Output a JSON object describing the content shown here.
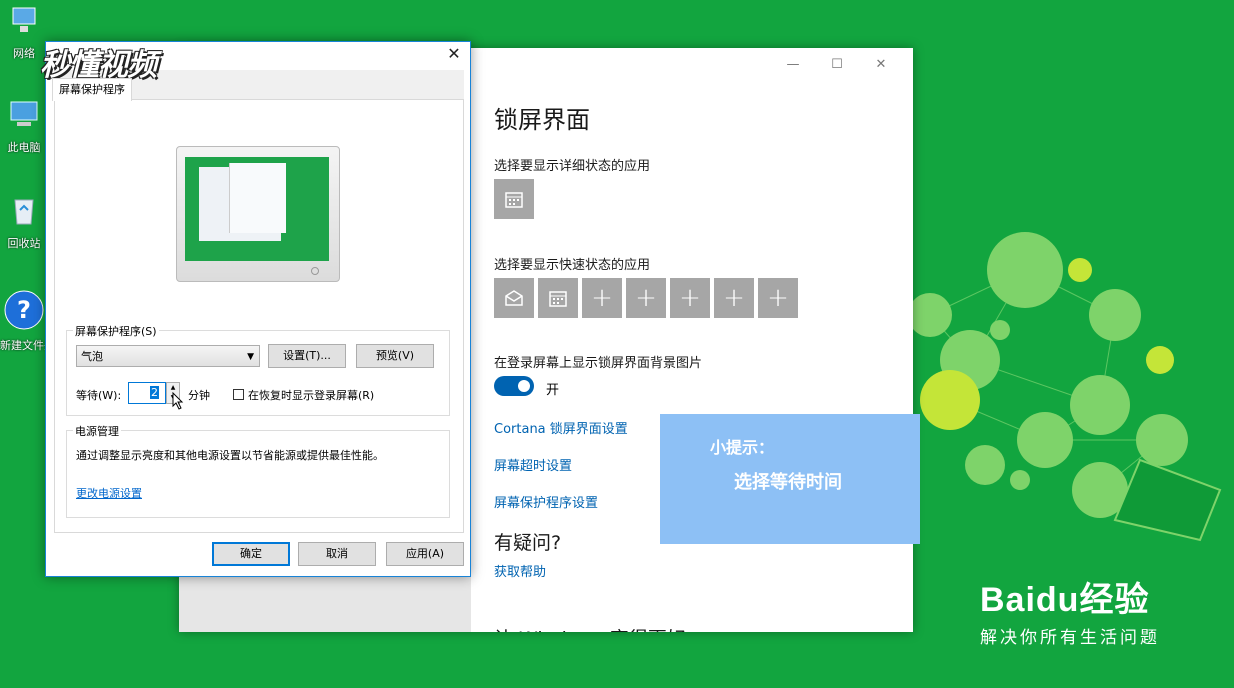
{
  "desktop": {
    "icons": [
      {
        "label": "网络",
        "icon": "network-icon"
      },
      {
        "label": "此电脑",
        "icon": "computer-icon"
      },
      {
        "label": "回收站",
        "icon": "recycle-bin-icon"
      },
      {
        "label": "新建文件夹",
        "icon": "help-file-icon"
      }
    ]
  },
  "watermark": {
    "text": "秒懂视频"
  },
  "settings": {
    "title": "锁屏界面",
    "detail_status_label": "选择要显示详细状态的应用",
    "quick_status_label": "选择要显示快速状态的应用",
    "bg_label": "在登录屏幕上显示锁屏界面背景图片",
    "toggle_state": "开",
    "links": [
      "Cortana 锁屏界面设置",
      "屏幕超时设置",
      "屏幕保护程序设置"
    ],
    "question": "有疑问?",
    "help_link": "获取帮助",
    "cut_text": "让 Windows 变得更好",
    "window_controls": {
      "minimize": "—",
      "maximize": "☐",
      "close": "✕"
    }
  },
  "dialog": {
    "close": "✕",
    "tab_label": "屏幕保护程序",
    "ss_group_label": "屏幕保护程序(S)",
    "ss_selected": "气泡",
    "settings_button": "设置(T)...",
    "preview_button": "预览(V)",
    "wait_label": "等待(W):",
    "wait_value": "2",
    "wait_unit": "分钟",
    "resume_checkbox_label": "在恢复时显示登录屏幕(R)",
    "resume_checked": false,
    "power_group_label": "电源管理",
    "power_text": "通过调整显示亮度和其他电源设置以节省能源或提供最佳性能。",
    "power_link": "更改电源设置",
    "ok_button": "确定",
    "cancel_button": "取消",
    "apply_button": "应用(A)"
  },
  "tip": {
    "title": "小提示：",
    "body": "选择等待时间"
  },
  "baidu": {
    "brand": "Baidu经验",
    "slogan": "解决你所有生活问题"
  }
}
